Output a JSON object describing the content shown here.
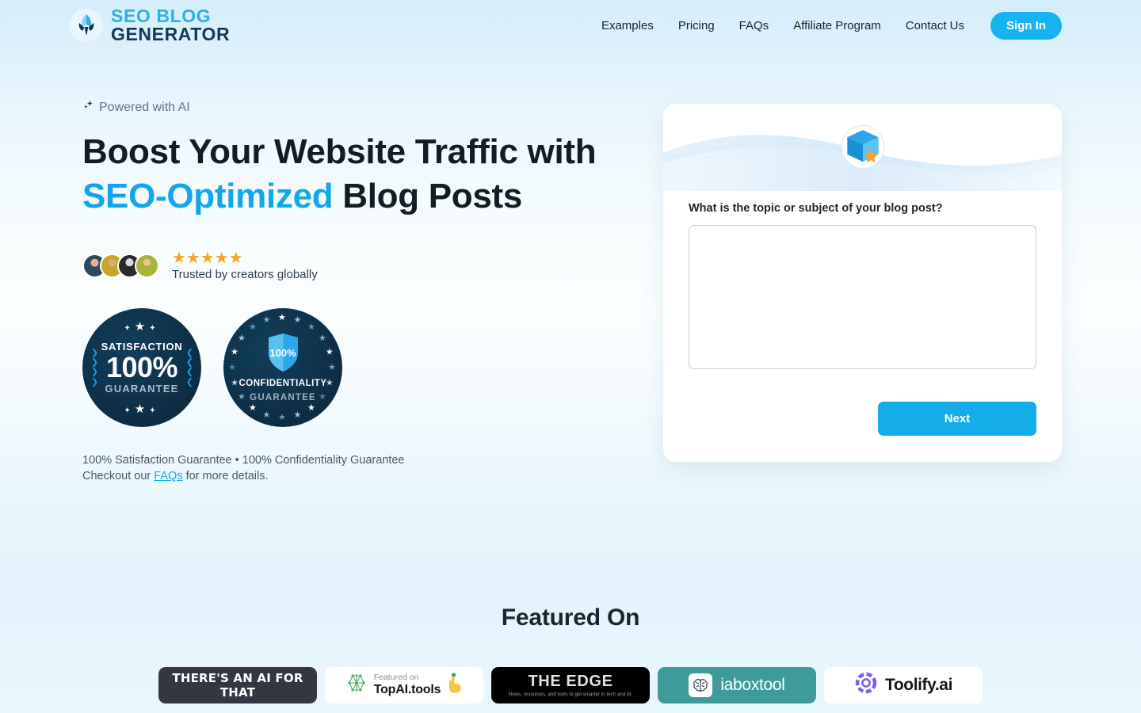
{
  "brand": {
    "logo_line1": "SEO BLOG",
    "logo_line2": "GENERATOR",
    "logo_icon": "feather-quill-icon",
    "accent_color": "#17b2f0",
    "dark_color": "#123a55"
  },
  "nav": {
    "links": [
      {
        "label": "Examples"
      },
      {
        "label": "Pricing"
      },
      {
        "label": "FAQs"
      },
      {
        "label": "Affiliate Program"
      },
      {
        "label": "Contact Us"
      }
    ],
    "signin_label": "Sign In"
  },
  "hero": {
    "eyebrow": "Powered with AI",
    "eyebrow_icon": "sparkle-icon",
    "headline_line1": "Boost Your Website Traffic with",
    "headline_accent": "SEO-Optimized",
    "headline_tail": " Blog Posts",
    "social_proof": {
      "stars": "★★★★★",
      "star_count": 5,
      "trusted_text": "Trusted by creators globally",
      "avatar_count": 4
    },
    "badges": [
      {
        "name": "satisfaction-guarantee-badge",
        "title": "SATISFACTION",
        "number": "100%",
        "subtitle": "GUARANTEE"
      },
      {
        "name": "confidentiality-guarantee-badge",
        "shield_number": "100%",
        "title": "CONFIDENTIALITY",
        "subtitle": "GUARANTEE"
      }
    ],
    "guarantee_line1": "100% Satisfaction Guarantee • 100% Confidentiality Guarantee",
    "guarantee_line2_prefix": "Checkout our ",
    "guarantee_link": "FAQs",
    "guarantee_line2_suffix": " for more details."
  },
  "form_card": {
    "icon": "box-star-icon",
    "field_label": "What is the topic or subject of your blog post?",
    "topic_value": "",
    "topic_placeholder": "",
    "next_label": "Next"
  },
  "featured": {
    "title": "Featured On",
    "logos": [
      {
        "name": "theres-an-ai-for-that",
        "text": "THERE'S AN AI FOR THAT"
      },
      {
        "name": "topai-tools",
        "small": "Featured on",
        "large": "TopAI.tools",
        "icon": "network-graph-icon"
      },
      {
        "name": "the-edge",
        "text": "THE EDGE",
        "tagline": "News, resources, and tools to get smarter in tech and AI."
      },
      {
        "name": "iaboxtool",
        "text": "iaboxtool",
        "icon": "brain-icon"
      },
      {
        "name": "toolify-ai",
        "text": "Toolify.ai",
        "icon": "purple-ring-icon"
      }
    ]
  }
}
